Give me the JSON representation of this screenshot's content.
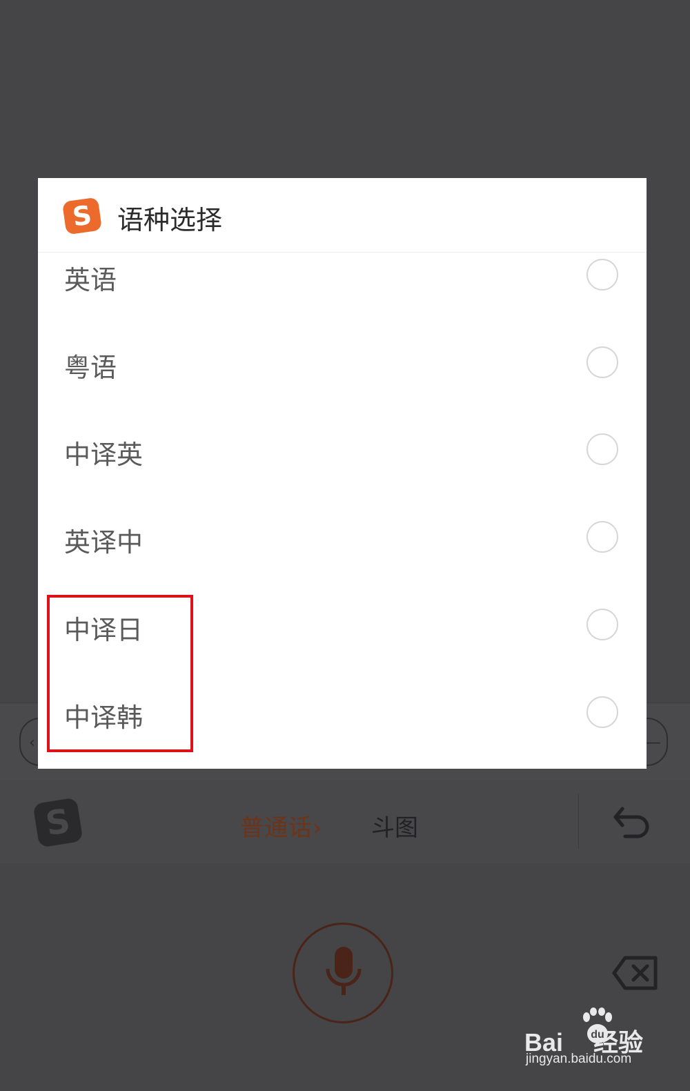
{
  "dialog": {
    "title": "语种选择",
    "app_icon_letter": "S",
    "options": [
      {
        "label": "英语",
        "selected": false
      },
      {
        "label": "粤语",
        "selected": false
      },
      {
        "label": "中译英",
        "selected": false
      },
      {
        "label": "英译中",
        "selected": false
      },
      {
        "label": "中译日",
        "selected": false
      },
      {
        "label": "中译韩",
        "selected": false
      }
    ]
  },
  "keyboard": {
    "logo_letter": "S",
    "mandarin_label": "普通话›",
    "meme_label": "斗图",
    "left_pill_glyph": "‹",
    "right_pill_glyph": "—"
  },
  "watermark": {
    "brand": "Bai",
    "brand_suffix": "经验",
    "url": "jingyan.baidu.com"
  },
  "colors": {
    "overlay": "#454447",
    "accent_orange": "#ec6a2b",
    "highlight_red": "#e0101a"
  }
}
